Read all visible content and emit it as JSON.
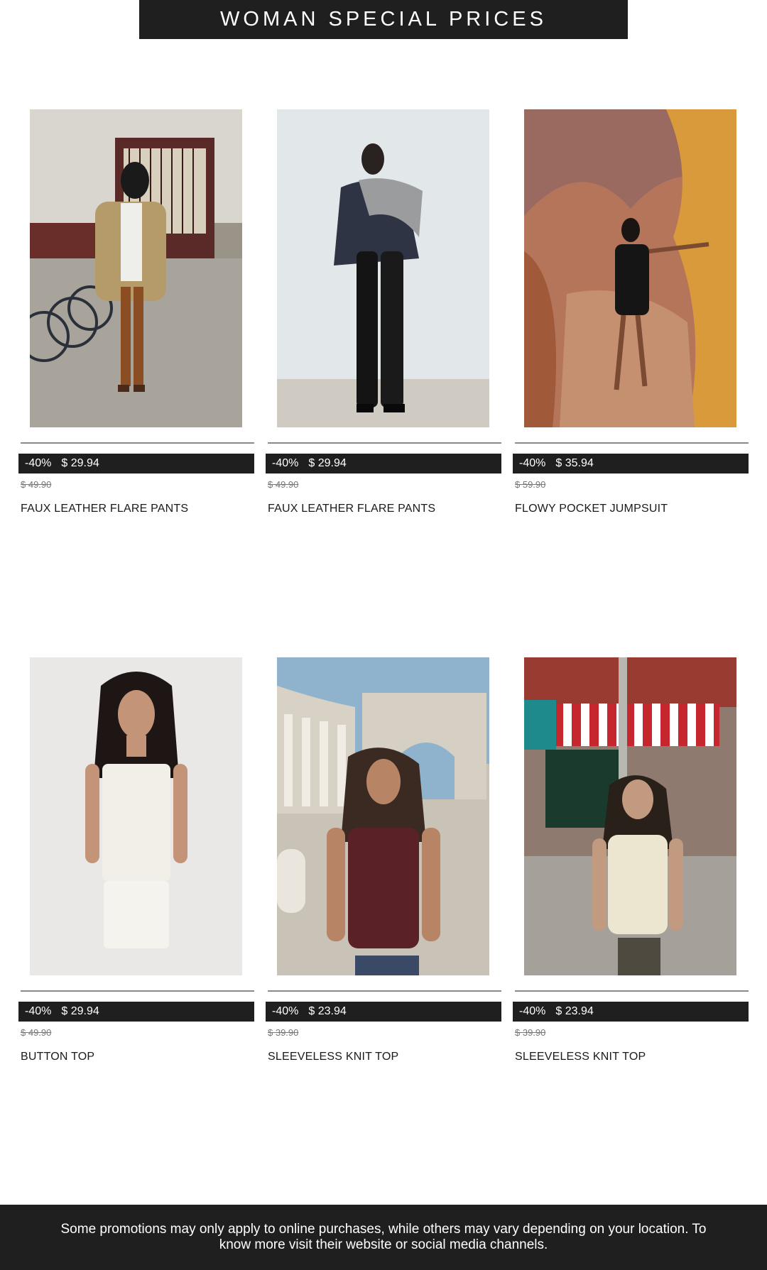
{
  "header": {
    "title": "WOMAN SPECIAL PRICES"
  },
  "products": [
    {
      "discount": "-40%",
      "price": "$ 29.94",
      "old_price": "$ 49.90",
      "name": "FAUX LEATHER FLARE PANTS"
    },
    {
      "discount": "-40%",
      "price": "$ 29.94",
      "old_price": "$ 49.90",
      "name": "FAUX LEATHER FLARE PANTS"
    },
    {
      "discount": "-40%",
      "price": "$ 35.94",
      "old_price": "$ 59.90",
      "name": "FLOWY POCKET JUMPSUIT"
    },
    {
      "discount": "-40%",
      "price": "$ 29.94",
      "old_price": "$ 49.90",
      "name": "BUTTON TOP"
    },
    {
      "discount": "-40%",
      "price": "$ 23.94",
      "old_price": "$ 39.90",
      "name": "SLEEVELESS KNIT TOP"
    },
    {
      "discount": "-40%",
      "price": "$ 23.94",
      "old_price": "$ 39.90",
      "name": "SLEEVELESS KNIT TOP"
    }
  ],
  "footer": {
    "text": "Some promotions may only apply to online purchases, while others may vary depending on your location. To know more visit their website or social media channels."
  }
}
